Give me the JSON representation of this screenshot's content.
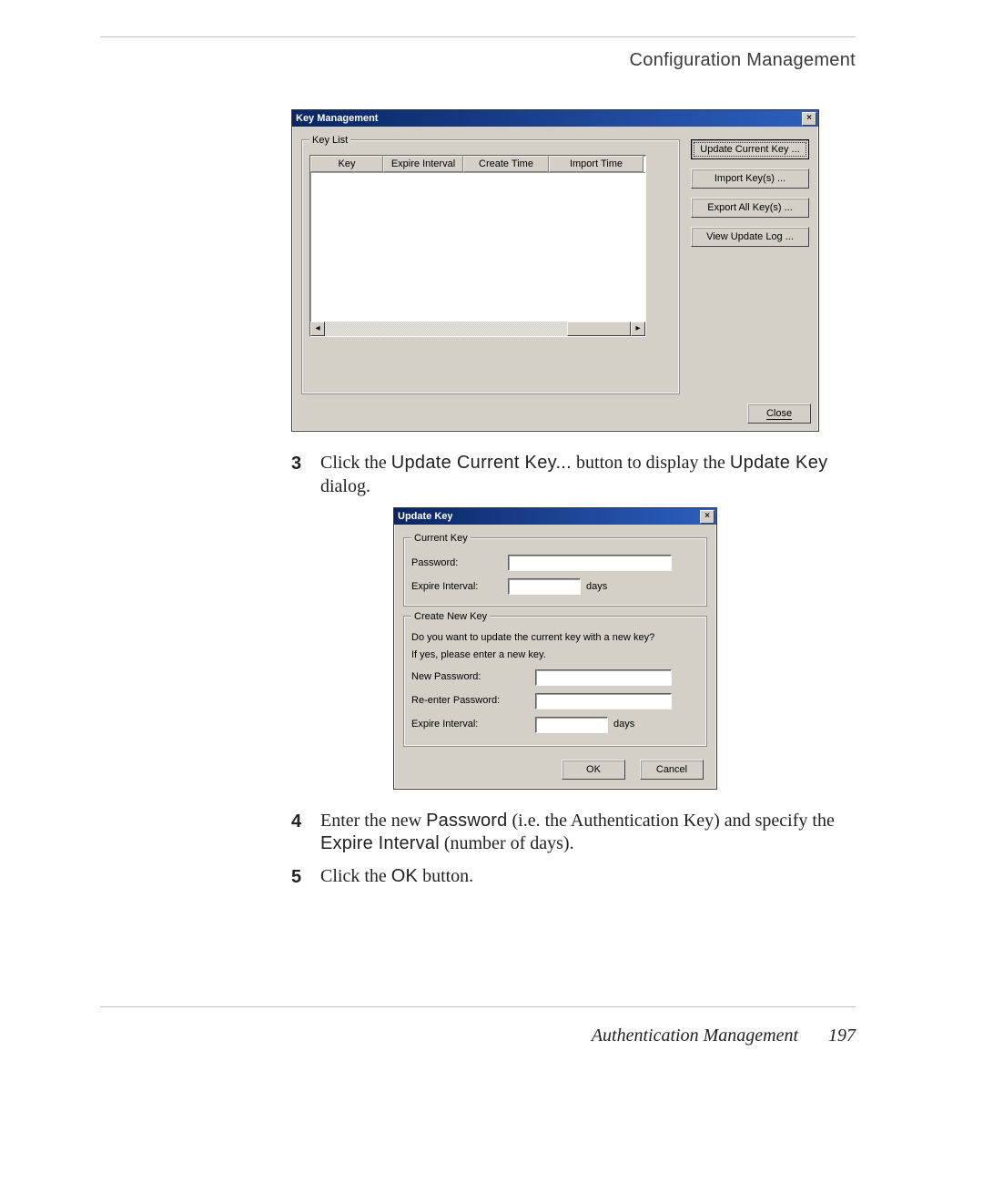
{
  "header": {
    "chapter": "Configuration Management"
  },
  "dlg1": {
    "title": "Key Management",
    "groupbox_label": "Key List",
    "columns": [
      "Key",
      "Expire Interval",
      "Create Time",
      "Import Time"
    ],
    "buttons": {
      "update": "Update Current Key ...",
      "import": "Import Key(s) ...",
      "export": "Export All Key(s) ...",
      "viewlog": "View Update Log ...",
      "close": "Close"
    }
  },
  "steps": {
    "s3": {
      "num": "3",
      "text_a": "Click the ",
      "ui1": "Update Current Key...",
      "text_b": " button to display the ",
      "ui2": "Update Key",
      "text_c": " dialog."
    },
    "s4": {
      "num": "4",
      "text_a": "Enter the new ",
      "ui1": "Password",
      "text_b": " (i.e. the Authentication Key) and specify the ",
      "ui2": "Expire Interval",
      "text_c": " (number of days)."
    },
    "s5": {
      "num": "5",
      "text_a": "Click the ",
      "ui1": "OK",
      "text_b": " button."
    }
  },
  "dlg2": {
    "title": "Update Key",
    "current_legend": "Current Key",
    "createnew_legend": "Create New Key",
    "labels": {
      "password": "Password:",
      "expire": "Expire Interval:",
      "days": "days",
      "question": "Do you want to update the current key with a new key?",
      "ifyes": "If yes, please enter a new key.",
      "newpw": "New Password:",
      "repw": "Re-enter Password:"
    },
    "buttons": {
      "ok": "OK",
      "cancel": "Cancel"
    }
  },
  "footer": {
    "section": "Authentication Management",
    "page": "197"
  }
}
